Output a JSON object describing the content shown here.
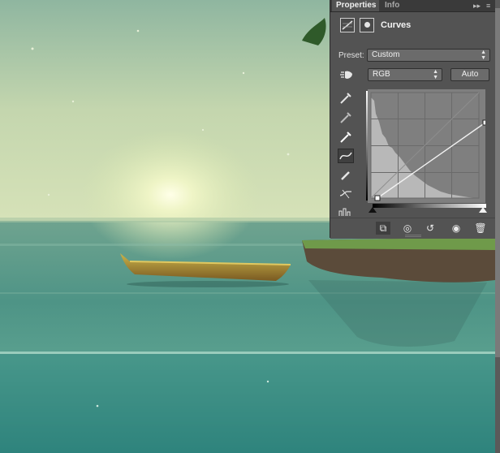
{
  "panel": {
    "tabs": [
      "Properties",
      "Info"
    ],
    "title": "Curves",
    "preset_label": "Preset:",
    "preset_value": "Custom",
    "channel_value": "RGB",
    "auto_label": "Auto",
    "icons": {
      "collapse": "double-chevron-right-icon",
      "menu": "panel-menu-icon",
      "adjustment": "curves-adjustment-icon",
      "mask": "layer-mask-icon",
      "targeted": "targeted-adjustment-hand-icon",
      "tools": [
        "black-point-eyedropper-icon",
        "gray-point-eyedropper-icon",
        "white-point-eyedropper-icon",
        "curve-edit-icon",
        "pencil-draw-icon",
        "smooth-curve-icon",
        "clipping-warning-icon"
      ],
      "bottom": [
        "clip-to-layer-icon",
        "view-previous-state-icon",
        "reset-icon",
        "visibility-eye-icon",
        "trash-icon"
      ]
    }
  },
  "curve": {
    "input_range": [
      0,
      255
    ],
    "points": [
      [
        0,
        0
      ],
      [
        255,
        255
      ]
    ],
    "adjusted_points": [
      [
        0,
        0
      ],
      [
        255,
        166
      ]
    ]
  },
  "colors": {
    "panel_bg": "#535353",
    "tab_bar": "#3a3a3a",
    "histogram": "#b8b8b8",
    "graph_bg": "#7f7f7f",
    "sky": "#c8d8a8",
    "water": "#3f8c80"
  }
}
